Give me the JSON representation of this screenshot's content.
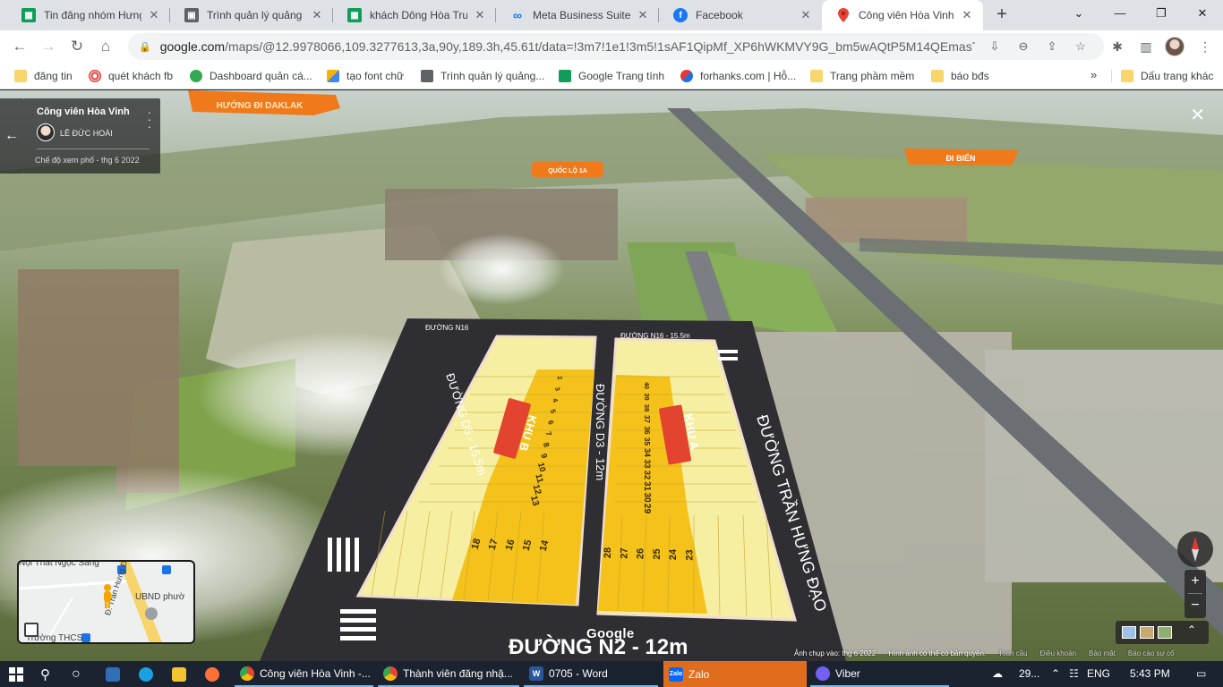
{
  "browser": {
    "tabs": [
      {
        "label": "Tin đăng nhóm Hưng",
        "icon": "google-sheets-icon",
        "color": "#0f9d58",
        "active": false
      },
      {
        "label": "Trình quản lý quảng cá",
        "icon": "ads-manager-icon",
        "color": "#5f6368",
        "active": false
      },
      {
        "label": "khách Dông Hòa Trun",
        "icon": "google-sheets-icon",
        "color": "#0f9d58",
        "active": false
      },
      {
        "label": "Meta Business Suite",
        "icon": "meta-icon",
        "color": "#1877f2",
        "active": false
      },
      {
        "label": "Facebook",
        "icon": "facebook-icon",
        "color": "#1877f2",
        "active": false
      },
      {
        "label": "Công viên Hòa Vinh -",
        "icon": "google-maps-icon",
        "color": "#ea4335",
        "active": true
      }
    ],
    "new_tab_label": "+",
    "window_controls": {
      "chevron": "⌄",
      "minimize": "—",
      "restore": "❐",
      "close": "✕"
    },
    "url_host": "google.com",
    "url_path": "/maps/@12.9978066,109.3277613,3a,90y,189.3h,45.61t/data=!3m7!1e1!3m5!1sAF1QipMf_XP6hWKMVY9G_bm5wAQtP5M14QEmasTO0...",
    "bookmarks": [
      {
        "label": "đăng tin",
        "icon": "folder-icon"
      },
      {
        "label": "quét khách fb",
        "icon": "target-icon"
      },
      {
        "label": "Dashboard quản cá...",
        "icon": "dashboard-icon"
      },
      {
        "label": "tạo font chữ",
        "icon": "font-icon"
      },
      {
        "label": "Trình quản lý quảng...",
        "icon": "ads-manager-icon"
      },
      {
        "label": "Google Trang tính",
        "icon": "google-sheets-icon"
      },
      {
        "label": "forhanks.com | Hỗ...",
        "icon": "forhanks-icon"
      },
      {
        "label": "Trang phầm mềm",
        "icon": "folder-icon"
      },
      {
        "label": "báo bđs",
        "icon": "folder-icon"
      }
    ],
    "bookmarks_more": "»",
    "other_bookmarks": "Dấu trang khác"
  },
  "map": {
    "place_name": "Công viên Hòa Vinh",
    "author": "LÊ ĐỨC HOÀI",
    "capture_mode": "Chế độ xem phố - thg 6 2022",
    "google_logo": "Google",
    "attribution": {
      "captured": "Ảnh chụp vào: thg 6 2022",
      "copyright": "Hình ảnh có thể có bản quyền.",
      "global": "Toàn cầu",
      "terms": "Điều khoản",
      "privacy": "Bảo mật",
      "report": "Báo cáo sự cố"
    },
    "zoom_in": "+",
    "zoom_out": "−",
    "minimap": {
      "label_top": "Nội Thất Ngọc Sang",
      "label_ubnd": "UBND phườ",
      "label_street": "Đ. Trần Hưng Đ",
      "label_school": "Trường THCS"
    },
    "signs": {
      "huong_daklak": "HƯỚNG ĐI DAKLAK",
      "quoc_lo": "QUỐC LỘ 1A",
      "bien": "ĐI BIỂN",
      "duong_n16_left": "ĐƯỜNG N16",
      "duong_n16": "ĐƯỜNG N16 - 15.5m",
      "duong_d5": "ĐƯỜNG D5 - 15.5m",
      "duong_d3": "ĐƯỜNG D3 - 12m",
      "tran_hung_dao": "ĐƯỜNG TRẦN HƯNG ĐẠO",
      "duong_n2": "ĐƯỜNG N2 - 12m",
      "khu_a": "KHU A",
      "khu_b": "KHU B"
    },
    "lots_khu_b_col": [
      "2",
      "3",
      "4",
      "5",
      "6",
      "7",
      "8",
      "9",
      "10",
      "11",
      "12",
      "13"
    ],
    "lots_khu_b_bottom": [
      "18",
      "17",
      "16",
      "15",
      "14"
    ],
    "lots_khu_a_col": [
      "40",
      "39",
      "38",
      "37",
      "36",
      "35",
      "34",
      "33",
      "32",
      "31",
      "30",
      "29"
    ],
    "lots_khu_a_bottom": [
      "28",
      "27",
      "26",
      "25",
      "24",
      "23"
    ],
    "accent_colors": {
      "lot_yellow": "#f4c21b",
      "lot_pale": "#f6efa1",
      "sign_orange": "#f07a1a",
      "khu_red": "#e2442f",
      "road": "#2e2e33"
    }
  },
  "taskbar": {
    "apps": [
      {
        "label": "Công viên Hòa Vinh -...",
        "icon": "chrome-icon"
      },
      {
        "label": "Thành viên đăng nhậ...",
        "icon": "chrome-icon"
      },
      {
        "label": "0705 - Word",
        "icon": "word-icon"
      },
      {
        "label": "Zalo",
        "icon": "zalo-icon"
      },
      {
        "label": "Viber",
        "icon": "viber-icon"
      }
    ],
    "weather": "29...",
    "language": "ENG",
    "time": "5:43 PM"
  }
}
